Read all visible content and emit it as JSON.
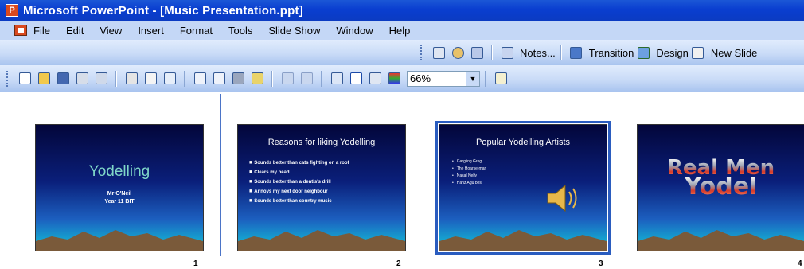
{
  "window": {
    "title": "Microsoft PowerPoint - [Music Presentation.ppt]"
  },
  "menu": [
    "File",
    "Edit",
    "View",
    "Insert",
    "Format",
    "Tools",
    "Slide Show",
    "Window",
    "Help"
  ],
  "toolbar_top": {
    "notes_label": "Notes...",
    "transition_label": "Transition",
    "design_label": "Design",
    "new_slide_label": "New Slide"
  },
  "toolbar_std": {
    "zoom_value": "66%"
  },
  "slides": [
    {
      "number": "1",
      "title": "Yodelling",
      "subtitle_lines": [
        "Mr O'Neil",
        "Year 11 BIT"
      ]
    },
    {
      "number": "2",
      "title": "Reasons for liking Yodelling",
      "bullets": [
        "Sounds better than cats fighting on a roof",
        "Clears my head",
        "Sounds better than a dentis's drill",
        "Annoys my next door neighbour",
        "Sounds better than country music"
      ]
    },
    {
      "number": "3",
      "title": "Popular Yodelling Artists",
      "bullets": [
        "Gargling Greg",
        "The Hoarse-man",
        "Nasal Nelly",
        "Hanz Agu bes"
      ]
    },
    {
      "number": "4",
      "wordart_lines": [
        "Real Men",
        "Yodel"
      ]
    }
  ],
  "colors": {
    "title_bar": "#0b3bc2",
    "menu_bar": "#c4d7f6",
    "selection": "#2a5cbf"
  }
}
